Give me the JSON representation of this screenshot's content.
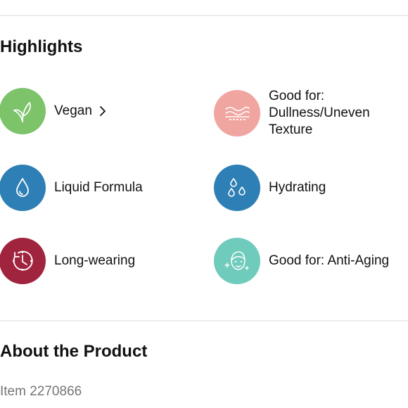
{
  "highlights": {
    "title": "Highlights",
    "items": [
      {
        "label": "Vegan",
        "icon": "vegan-leaf-icon",
        "color": "#7cc36a",
        "has_link": true
      },
      {
        "label_lines": [
          "Good for:",
          "Dullness/Uneven",
          "Texture"
        ],
        "icon": "skin-texture-icon",
        "color": "#f0a5a0"
      },
      {
        "label": "Liquid Formula",
        "icon": "liquid-drop-icon",
        "color": "#2e7fb5"
      },
      {
        "label": "Hydrating",
        "icon": "water-drops-icon",
        "color": "#2e7fb5"
      },
      {
        "label": "Long-wearing",
        "icon": "clock-icon",
        "color": "#a1243f"
      },
      {
        "label": "Good for: Anti-Aging",
        "icon": "face-sparkle-icon",
        "color": "#6fcbbb"
      }
    ]
  },
  "about": {
    "title": "About the Product",
    "item_number": "Item 2270866"
  }
}
